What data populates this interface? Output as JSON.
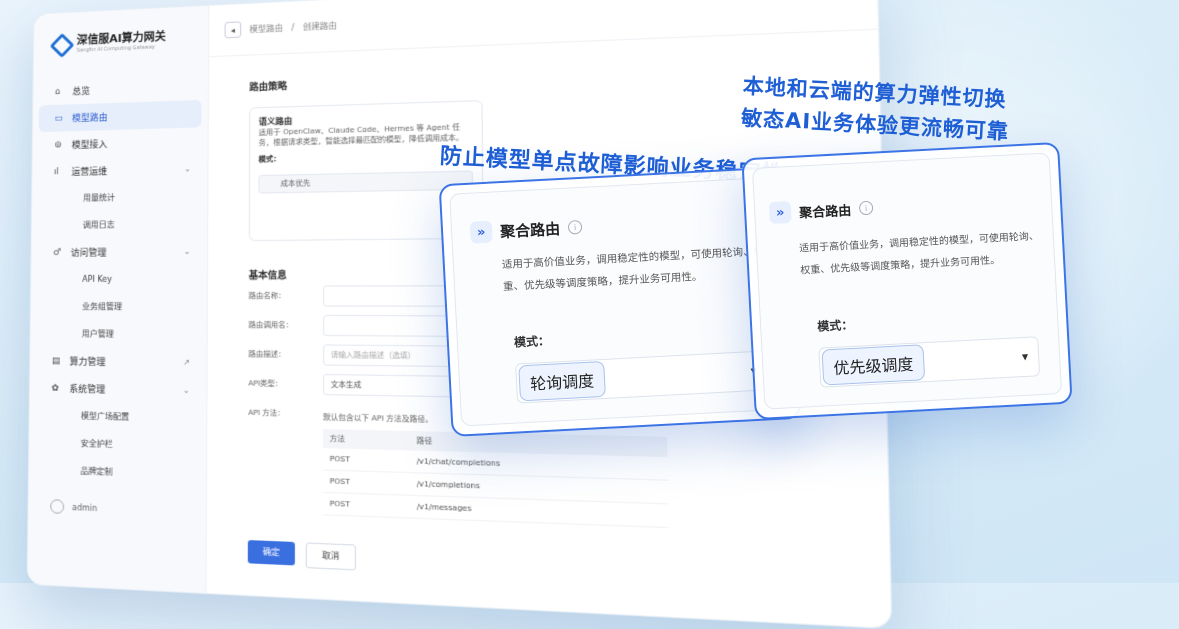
{
  "app": {
    "logo_title": "深信服AI算力网关",
    "logo_subtitle": "Sangfor AI Computing Gateway"
  },
  "breadcrumb": {
    "parent": "模型路由",
    "separator": "/",
    "current": "创建路由"
  },
  "sidebar": {
    "items": [
      {
        "label": "总览",
        "icon": "home-icon"
      },
      {
        "label": "模型路由",
        "icon": "route-icon"
      },
      {
        "label": "模型接入",
        "icon": "plug-icon"
      },
      {
        "label": "运营运维",
        "icon": "chart-icon"
      },
      {
        "label": "用量统计"
      },
      {
        "label": "调用日志"
      },
      {
        "label": "访问管理",
        "icon": "key-icon"
      },
      {
        "label": "API Key"
      },
      {
        "label": "业务组管理"
      },
      {
        "label": "用户管理"
      },
      {
        "label": "算力管理",
        "icon": "server-icon"
      },
      {
        "label": "系统管理",
        "icon": "gear-icon"
      },
      {
        "label": "模型广场配置"
      },
      {
        "label": "安全护栏"
      },
      {
        "label": "品牌定制"
      }
    ],
    "user": "admin"
  },
  "main": {
    "strategy_title": "路由策略",
    "strategy_card": {
      "name": "语义路由",
      "desc": "适用于 OpenClaw、Claude Code、Hermes 等 Agent 任务，根据请求类型，智能选择最匹配的模型，降低调用成本。",
      "mode_label": "模式：",
      "mode_value": "成本优先"
    },
    "basic_title": "基本信息",
    "fields": [
      {
        "label": "路由名称：",
        "value": ""
      },
      {
        "label": "路由调用名：",
        "value": ""
      },
      {
        "label": "路由描述：",
        "value": "请输入路由描述（选填）"
      },
      {
        "label": "API类型：",
        "value": "文本生成"
      }
    ],
    "api_label": "API 方法：",
    "api_note": "默认包含以下 API 方法及路径。",
    "api_table": {
      "headers": [
        "方法",
        "路径"
      ],
      "rows": [
        [
          "POST",
          "/v1/chat/completions"
        ],
        [
          "POST",
          "/v1/completions"
        ],
        [
          "POST",
          "/v1/messages"
        ]
      ]
    },
    "confirm": "确定",
    "cancel": "取消"
  },
  "headline_1": "防止模型单点故障影响业务稳定性",
  "headline_2_line1": "本地和云端的算力弹性切换",
  "headline_2_line2": "敏态AI业务体验更流畅可靠",
  "card_1": {
    "name": "聚合路由",
    "desc": "适用于高价值业务，调用稳定性的模型，可使用轮询、权重、优先级等调度策略，提升业务可用性。",
    "mode_label": "模式：",
    "mode_value": "轮询调度"
  },
  "card_2": {
    "name": "聚合路由",
    "desc": "适用于高价值业务，调用稳定性的模型，可使用轮询、权重、优先级等调度策略，提升业务可用性。",
    "mode_label": "模式：",
    "mode_value": "优先级调度"
  },
  "colors": {
    "accent": "#1f5fd6",
    "primary_button": "#3a6fe0"
  }
}
